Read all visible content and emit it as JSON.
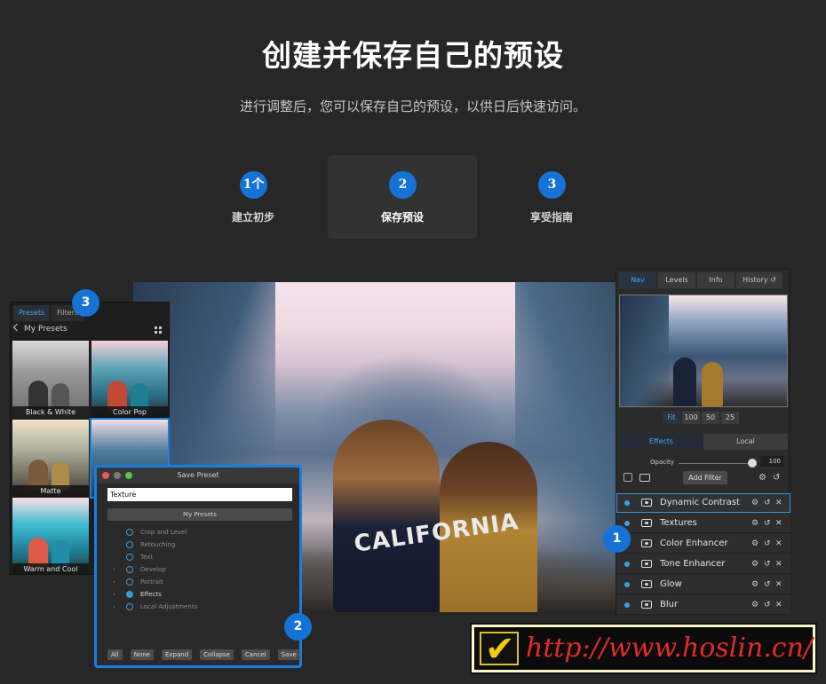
{
  "header": {
    "title": "创建并保存自己的预设",
    "subtitle": "进行调整后，您可以保存自己的预设，以供日后快速访问。"
  },
  "steps": [
    {
      "num": "1个",
      "label": "建立初步",
      "active": false
    },
    {
      "num": "2",
      "label": "保存预设",
      "active": true
    },
    {
      "num": "3",
      "label": "享受指南",
      "active": false
    }
  ],
  "photo": {
    "jacket_text": "CALIFORNIA"
  },
  "presets_panel": {
    "tabs": [
      "Presets",
      "Filters"
    ],
    "active_tab": "Presets",
    "back_label": "My Presets",
    "thumbnails": [
      {
        "label": "Black & White"
      },
      {
        "label": "Color Pop"
      },
      {
        "label": "Matte"
      },
      {
        "label": ""
      },
      {
        "label": "Warm and Cool"
      }
    ]
  },
  "save_preset": {
    "title": "Save Preset",
    "name_value": "Texture",
    "folder": "My Presets",
    "options": [
      {
        "label": "Crop and Level",
        "expand": false,
        "checked": false
      },
      {
        "label": "Retouching",
        "expand": false,
        "checked": false
      },
      {
        "label": "Text",
        "expand": false,
        "checked": false
      },
      {
        "label": "Develop",
        "expand": true,
        "checked": false
      },
      {
        "label": "Portrait",
        "expand": true,
        "checked": false
      },
      {
        "label": "Effects",
        "expand": true,
        "checked": true
      },
      {
        "label": "Local Adjustments",
        "expand": true,
        "checked": false
      }
    ],
    "buttons": [
      "All",
      "None",
      "Expand",
      "Collapse",
      "Cancel",
      "Save"
    ]
  },
  "right_panel": {
    "tabs": [
      "Nav",
      "Levels",
      "Info",
      "History"
    ],
    "active_tab": "Nav",
    "zoom": [
      "Fit",
      "100",
      "50",
      "25"
    ],
    "active_zoom": "Fit",
    "layer_tabs": [
      "Effects",
      "Local"
    ],
    "active_layer_tab": "Effects",
    "opacity_label": "Opacity",
    "opacity_value": "100",
    "add_filter": "Add Filter",
    "filters": [
      {
        "name": "Dynamic Contrast",
        "selected": true
      },
      {
        "name": "Textures",
        "selected": false
      },
      {
        "name": "Color Enhancer",
        "selected": false
      },
      {
        "name": "Tone Enhancer",
        "selected": false
      },
      {
        "name": "Glow",
        "selected": false
      },
      {
        "name": "Blur",
        "selected": false
      }
    ]
  },
  "badges": [
    "3",
    "1",
    "2"
  ],
  "watermark": {
    "url": "http://www.hoslin.cn/"
  },
  "colors": {
    "accent": "#1673d6",
    "background": "#272727",
    "watermark_red": "#e42a2a"
  },
  "icons": [
    "check-icon",
    "chevron-left-icon",
    "grid-icon",
    "gear-icon",
    "undo-icon",
    "close-icon",
    "eye-icon"
  ]
}
